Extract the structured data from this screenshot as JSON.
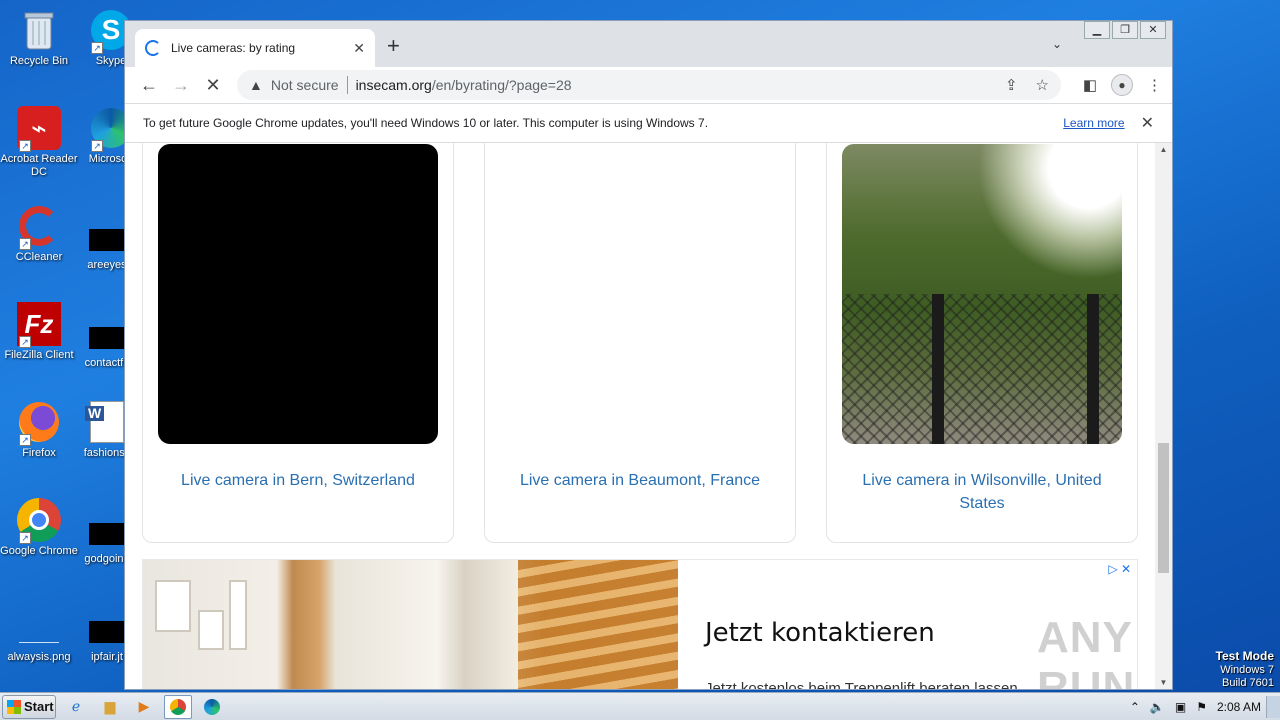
{
  "desktop": {
    "icons": [
      {
        "label": "Recycle Bin"
      },
      {
        "label": "Skype"
      },
      {
        "label": "Acrobat Reader DC"
      },
      {
        "label": "Microsoft"
      },
      {
        "label": "CCleaner"
      },
      {
        "label": "areeyes"
      },
      {
        "label": "FileZilla Client"
      },
      {
        "label": "contactfri"
      },
      {
        "label": "Firefox"
      },
      {
        "label": "fashionsy"
      },
      {
        "label": "Google Chrome"
      },
      {
        "label": "godgoing"
      },
      {
        "label": "alwaysis.png"
      },
      {
        "label": "ipfair.jt"
      }
    ]
  },
  "browser": {
    "tab_title": "Live cameras: by rating",
    "address": {
      "security_label": "Not secure",
      "host": "insecam.org",
      "path": "/en/byrating/?page=28"
    },
    "infobar": {
      "message": "To get future Google Chrome updates, you'll need Windows 10 or later. This computer is using Windows 7.",
      "link": "Learn more"
    }
  },
  "page": {
    "cameras": [
      {
        "caption": "Live camera in Bern, Switzerland"
      },
      {
        "caption": "Live camera in Beaumont, France"
      },
      {
        "caption": "Live camera in Wilsonville, United States"
      }
    ],
    "ad": {
      "title": "Jetzt kontaktieren",
      "subtitle": "Jetzt kostenlos beim Treppenlift beraten lassen"
    },
    "watermark": "ANY RUN"
  },
  "taskbar": {
    "start_label": "Start",
    "clock": "2:08 AM"
  },
  "system": {
    "test_mode_line1": "Test Mode",
    "test_mode_line2": "Windows 7",
    "test_mode_line3": "Build 7601"
  }
}
